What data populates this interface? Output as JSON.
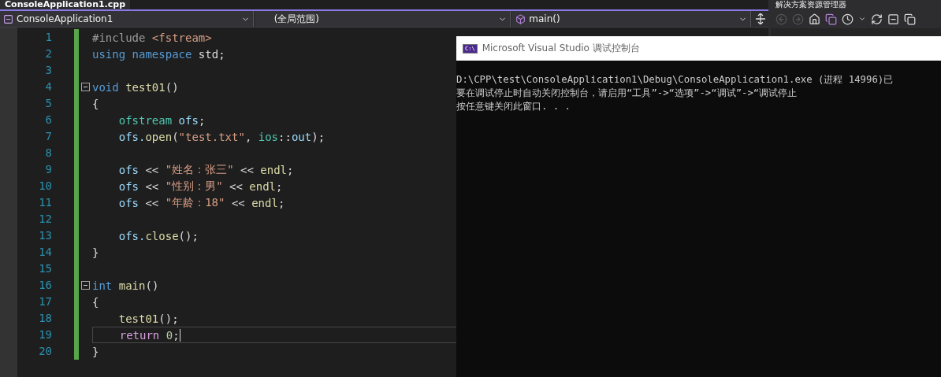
{
  "document_tab": {
    "title": "ConsoleApplication1.cpp"
  },
  "solution_explorer": {
    "title": "解决方案资源管理器"
  },
  "nav_bar": {
    "project": "ConsoleApplication1",
    "scope": "(全局范围)",
    "member": "main()"
  },
  "editor": {
    "lines": [
      {
        "number": "1",
        "fold": false,
        "selected": false,
        "tokens": [
          {
            "text": "#include",
            "kind": "preproc"
          },
          {
            "text": " <fstream>",
            "kind": "string"
          }
        ]
      },
      {
        "number": "2",
        "fold": false,
        "selected": false,
        "tokens": [
          {
            "text": "using namespace",
            "kind": "keyword"
          },
          {
            "text": " std;",
            "kind": "plain"
          }
        ]
      },
      {
        "number": "3",
        "fold": false,
        "selected": false
      },
      {
        "number": "4",
        "fold": true,
        "selected": false,
        "tokens": [
          {
            "text": "void",
            "kind": "keyword"
          },
          {
            "text": " test01",
            "kind": "func"
          },
          {
            "text": "()",
            "kind": "plain"
          }
        ]
      },
      {
        "number": "5",
        "fold": false,
        "selected": false,
        "tokens": [
          {
            "text": "{",
            "kind": "plain"
          }
        ]
      },
      {
        "number": "6",
        "fold": false,
        "selected": false,
        "tokens": [
          {
            "text": "    ofstream",
            "kind": "type"
          },
          {
            "text": " ofs",
            "kind": "variable"
          },
          {
            "text": ";",
            "kind": "plain"
          }
        ]
      },
      {
        "number": "7",
        "fold": false,
        "selected": false,
        "tokens": [
          {
            "text": "    ofs.",
            "kind": "variable"
          },
          {
            "text": "open",
            "kind": "func"
          },
          {
            "text": "(",
            "kind": "plain"
          },
          {
            "text": "\"test.txt\"",
            "kind": "string"
          },
          {
            "text": ",",
            "kind": "plain"
          },
          {
            "text": " ios",
            "kind": "type"
          },
          {
            "text": "::",
            "kind": "plain"
          },
          {
            "text": "out",
            "kind": "variable"
          },
          {
            "text": ");",
            "kind": "plain"
          }
        ]
      },
      {
        "number": "8",
        "fold": false,
        "selected": false
      },
      {
        "number": "9",
        "fold": false,
        "selected": false,
        "tokens": [
          {
            "text": "    ofs",
            "kind": "variable"
          },
          {
            "text": " <<",
            "kind": "plain"
          },
          {
            "text": " \"姓名：张三\"",
            "kind": "string"
          },
          {
            "text": " <<",
            "kind": "plain"
          },
          {
            "text": " endl",
            "kind": "func"
          },
          {
            "text": ";",
            "kind": "plain"
          }
        ]
      },
      {
        "number": "10",
        "fold": false,
        "selected": false,
        "tokens": [
          {
            "text": "    ofs",
            "kind": "variable"
          },
          {
            "text": " <<",
            "kind": "plain"
          },
          {
            "text": " \"性别：男\"",
            "kind": "string"
          },
          {
            "text": " <<",
            "kind": "plain"
          },
          {
            "text": " endl",
            "kind": "func"
          },
          {
            "text": ";",
            "kind": "plain"
          }
        ]
      },
      {
        "number": "11",
        "fold": false,
        "selected": false,
        "tokens": [
          {
            "text": "    ofs",
            "kind": "variable"
          },
          {
            "text": " <<",
            "kind": "plain"
          },
          {
            "text": " \"年龄：18\"",
            "kind": "string"
          },
          {
            "text": " <<",
            "kind": "plain"
          },
          {
            "text": " endl",
            "kind": "func"
          },
          {
            "text": ";",
            "kind": "plain"
          }
        ]
      },
      {
        "number": "12",
        "fold": false,
        "selected": false
      },
      {
        "number": "13",
        "fold": false,
        "selected": false,
        "tokens": [
          {
            "text": "    ofs.",
            "kind": "variable"
          },
          {
            "text": "close",
            "kind": "func"
          },
          {
            "text": "();",
            "kind": "plain"
          }
        ]
      },
      {
        "number": "14",
        "fold": false,
        "selected": false,
        "tokens": [
          {
            "text": "}",
            "kind": "plain"
          }
        ]
      },
      {
        "number": "15",
        "fold": false,
        "selected": false
      },
      {
        "number": "16",
        "fold": true,
        "selected": false,
        "tokens": [
          {
            "text": "int",
            "kind": "keyword"
          },
          {
            "text": " main",
            "kind": "func"
          },
          {
            "text": "()",
            "kind": "plain"
          }
        ]
      },
      {
        "number": "17",
        "fold": false,
        "selected": false,
        "tokens": [
          {
            "text": "{",
            "kind": "plain"
          }
        ]
      },
      {
        "number": "18",
        "fold": false,
        "selected": false,
        "tokens": [
          {
            "text": "    test01",
            "kind": "func"
          },
          {
            "text": "();",
            "kind": "plain"
          }
        ]
      },
      {
        "number": "19",
        "fold": false,
        "selected": true,
        "tokens": [
          {
            "text": "    return",
            "kind": "control"
          },
          {
            "text": " 0",
            "kind": "number"
          },
          {
            "text": ";",
            "kind": "plain"
          }
        ]
      },
      {
        "number": "20",
        "fold": false,
        "selected": false,
        "tokens": [
          {
            "text": "}",
            "kind": "plain"
          }
        ]
      }
    ]
  },
  "console": {
    "title": "Microsoft Visual Studio 调试控制台",
    "icon_text": "C:\\",
    "lines": [
      "D:\\CPP\\test\\ConsoleApplication1\\Debug\\ConsoleApplication1.exe (进程 14996)已",
      "要在调试停止时自动关闭控制台，请启用“工具”->“选项”->“调试”->“调试停止",
      "按任意键关闭此窗口. . ."
    ]
  }
}
